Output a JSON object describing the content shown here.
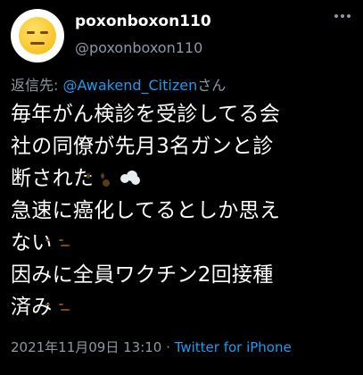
{
  "user": {
    "display_name": "poxonboxon110",
    "handle": "@poxonboxon110",
    "avatar_icon": "expressionless-face-emoji"
  },
  "reply": {
    "prefix": "返信先: ",
    "mention": "@Awakend_Citizen",
    "suffix": "さん"
  },
  "tweet": {
    "lines": [
      "毎年がん検診を受診してる会",
      "社の同僚が先月3名ガンと診",
      "断された",
      "急速に癌化してるとしか思え",
      "ない",
      "因みに全員ワクチン2回接種",
      "済み"
    ],
    "emojis": [
      "astonished-face",
      "dashing-away",
      "expressionless-face",
      "expressionless-face"
    ]
  },
  "meta": {
    "timestamp": "2021年11月09日 13:10",
    "separator": " · ",
    "source": "Twitter for iPhone"
  },
  "colors": {
    "background": "#000000",
    "text": "#ffffff",
    "muted": "#8b98a5",
    "link": "#1d9bf0"
  }
}
